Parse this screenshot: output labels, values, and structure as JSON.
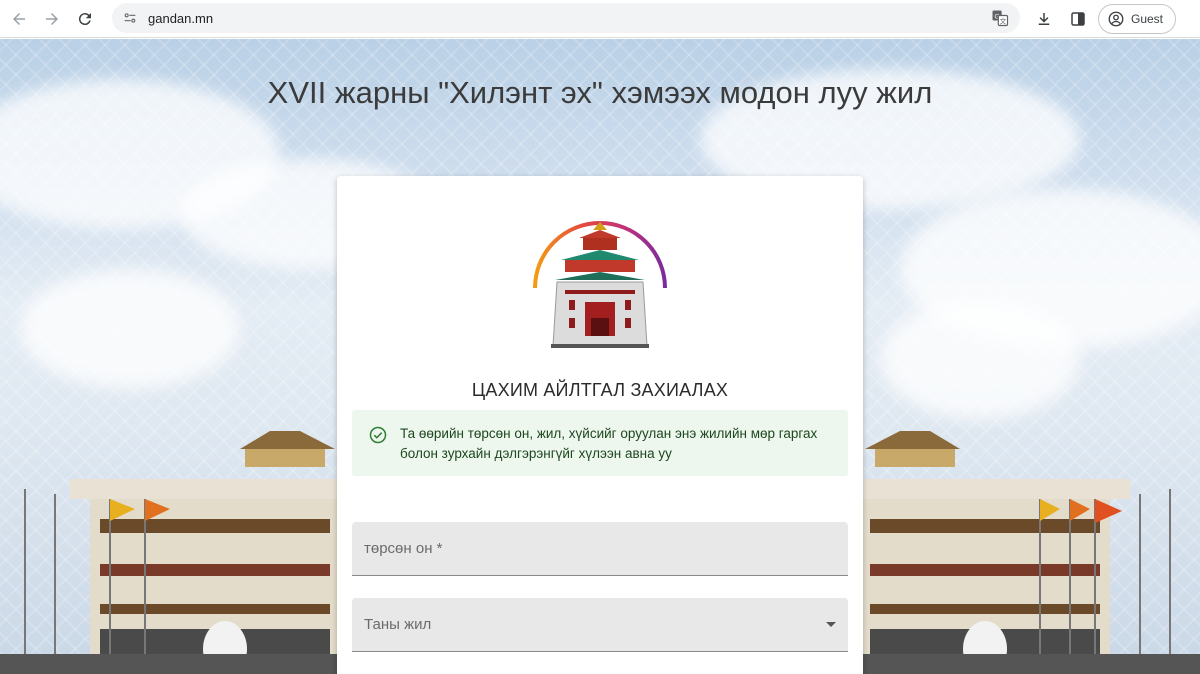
{
  "browser": {
    "url": "gandan.mn",
    "profile_label": "Guest"
  },
  "page": {
    "title": "XVII жарны \"Хилэнт эх\" хэмээх модон луу жил"
  },
  "card": {
    "heading": "ЦАХИМ АЙЛТГАЛ ЗАХИАЛАХ",
    "alert_text": "Та өөрийн төрсөн он, жил, хүйсийг оруулан энэ жилийн мөр гаргах болон зурхайн дэлгэрэнгүйг хүлээн авна уу",
    "birth_year_label": "төрсөн он *",
    "year_select_label": "Таны жил"
  },
  "colors": {
    "alert_bg": "#edf7ed",
    "alert_icon": "#2e7d32",
    "field_bg": "#e8e8e8"
  }
}
